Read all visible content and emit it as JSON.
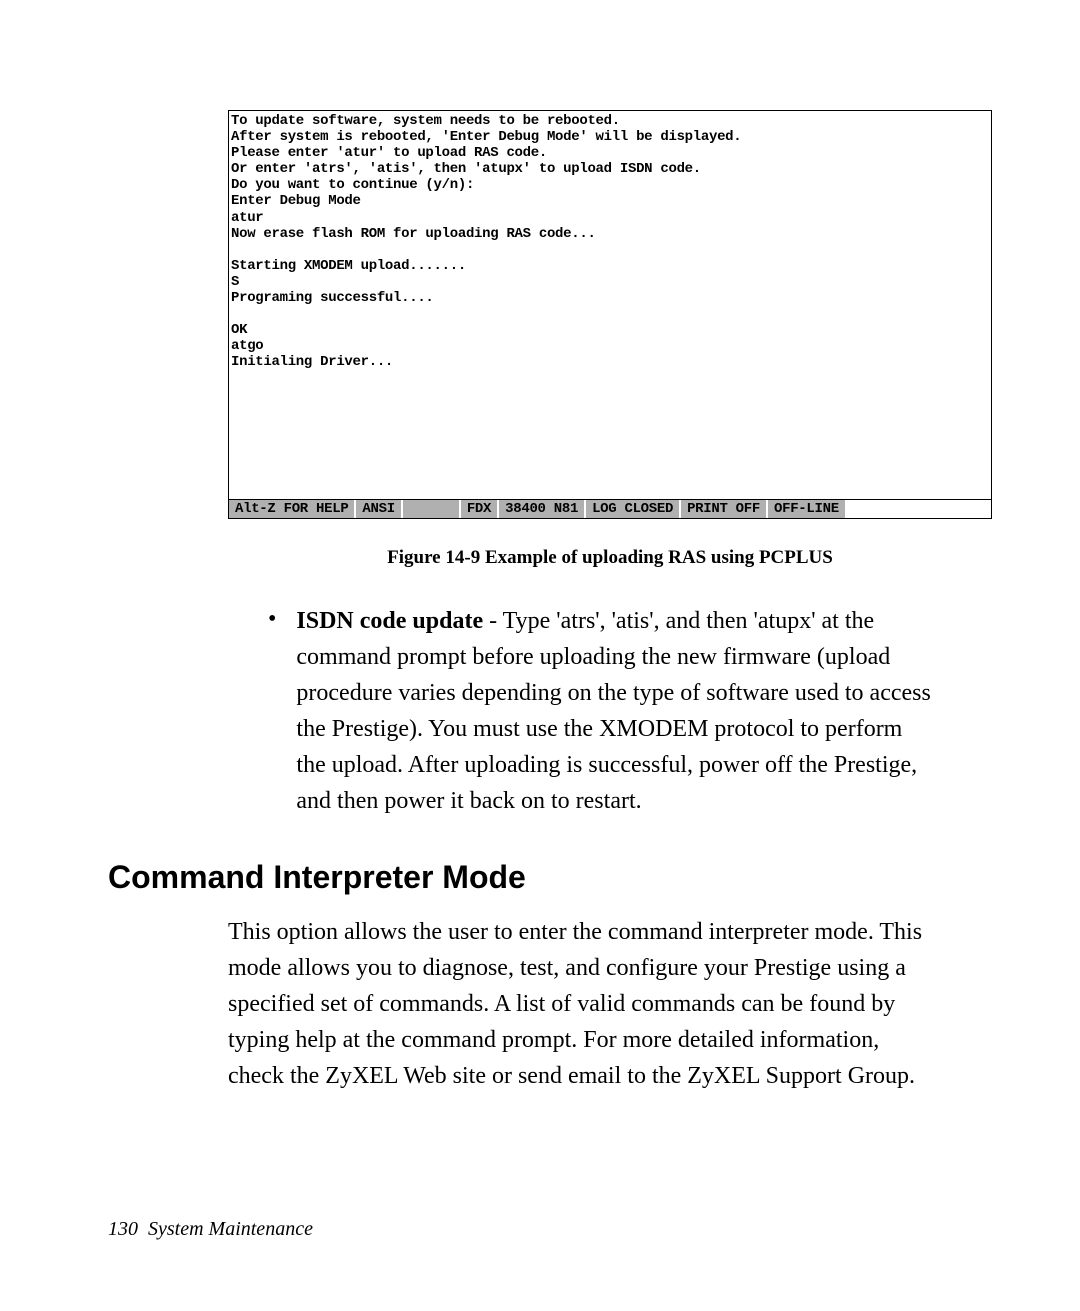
{
  "terminal": {
    "lines": [
      "To update software, system needs to be rebooted.",
      "After system is rebooted, 'Enter Debug Mode' will be displayed.",
      "Please enter 'atur' to upload RAS code.",
      "Or enter 'atrs', 'atis', then 'atupx' to upload ISDN code.",
      "Do you want to continue (y/n):",
      "Enter Debug Mode",
      "atur",
      "Now erase flash ROM for uploading RAS code...",
      "",
      "Starting XMODEM upload.......",
      "S",
      "Programing successful....",
      "",
      "OK",
      "atgo",
      "Initialing Driver...",
      "",
      "",
      "",
      "",
      ""
    ],
    "status": {
      "help": "Alt-Z FOR HELP",
      "ansi": "ANSI",
      "fdx": "FDX",
      "baud": "38400 N81",
      "log": "LOG CLOSED",
      "print": "PRINT OFF",
      "offline": "OFF-LINE"
    }
  },
  "figure": {
    "caption": "Figure 14-9 Example of uploading RAS using PCPLUS"
  },
  "bullet": {
    "title": "ISDN code update",
    "body": " - Type 'atrs', 'atis', and then 'atupx' at the command prompt before uploading the new firmware (upload procedure varies depending on the type of software used to access the Prestige). You must use the XMODEM protocol to perform the upload. After uploading is successful, power off the Prestige, and then power it back on to restart."
  },
  "heading": "Command Interpreter Mode",
  "paragraph": "This option allows the user to enter the command interpreter mode. This mode allows you to diagnose, test, and configure your Prestige using a specified set of commands. A list of valid commands can be found by typing help at the command prompt. For more detailed information, check the ZyXEL Web site or send email to the ZyXEL Support Group.",
  "footer": {
    "page": "130",
    "title": "System Maintenance"
  }
}
